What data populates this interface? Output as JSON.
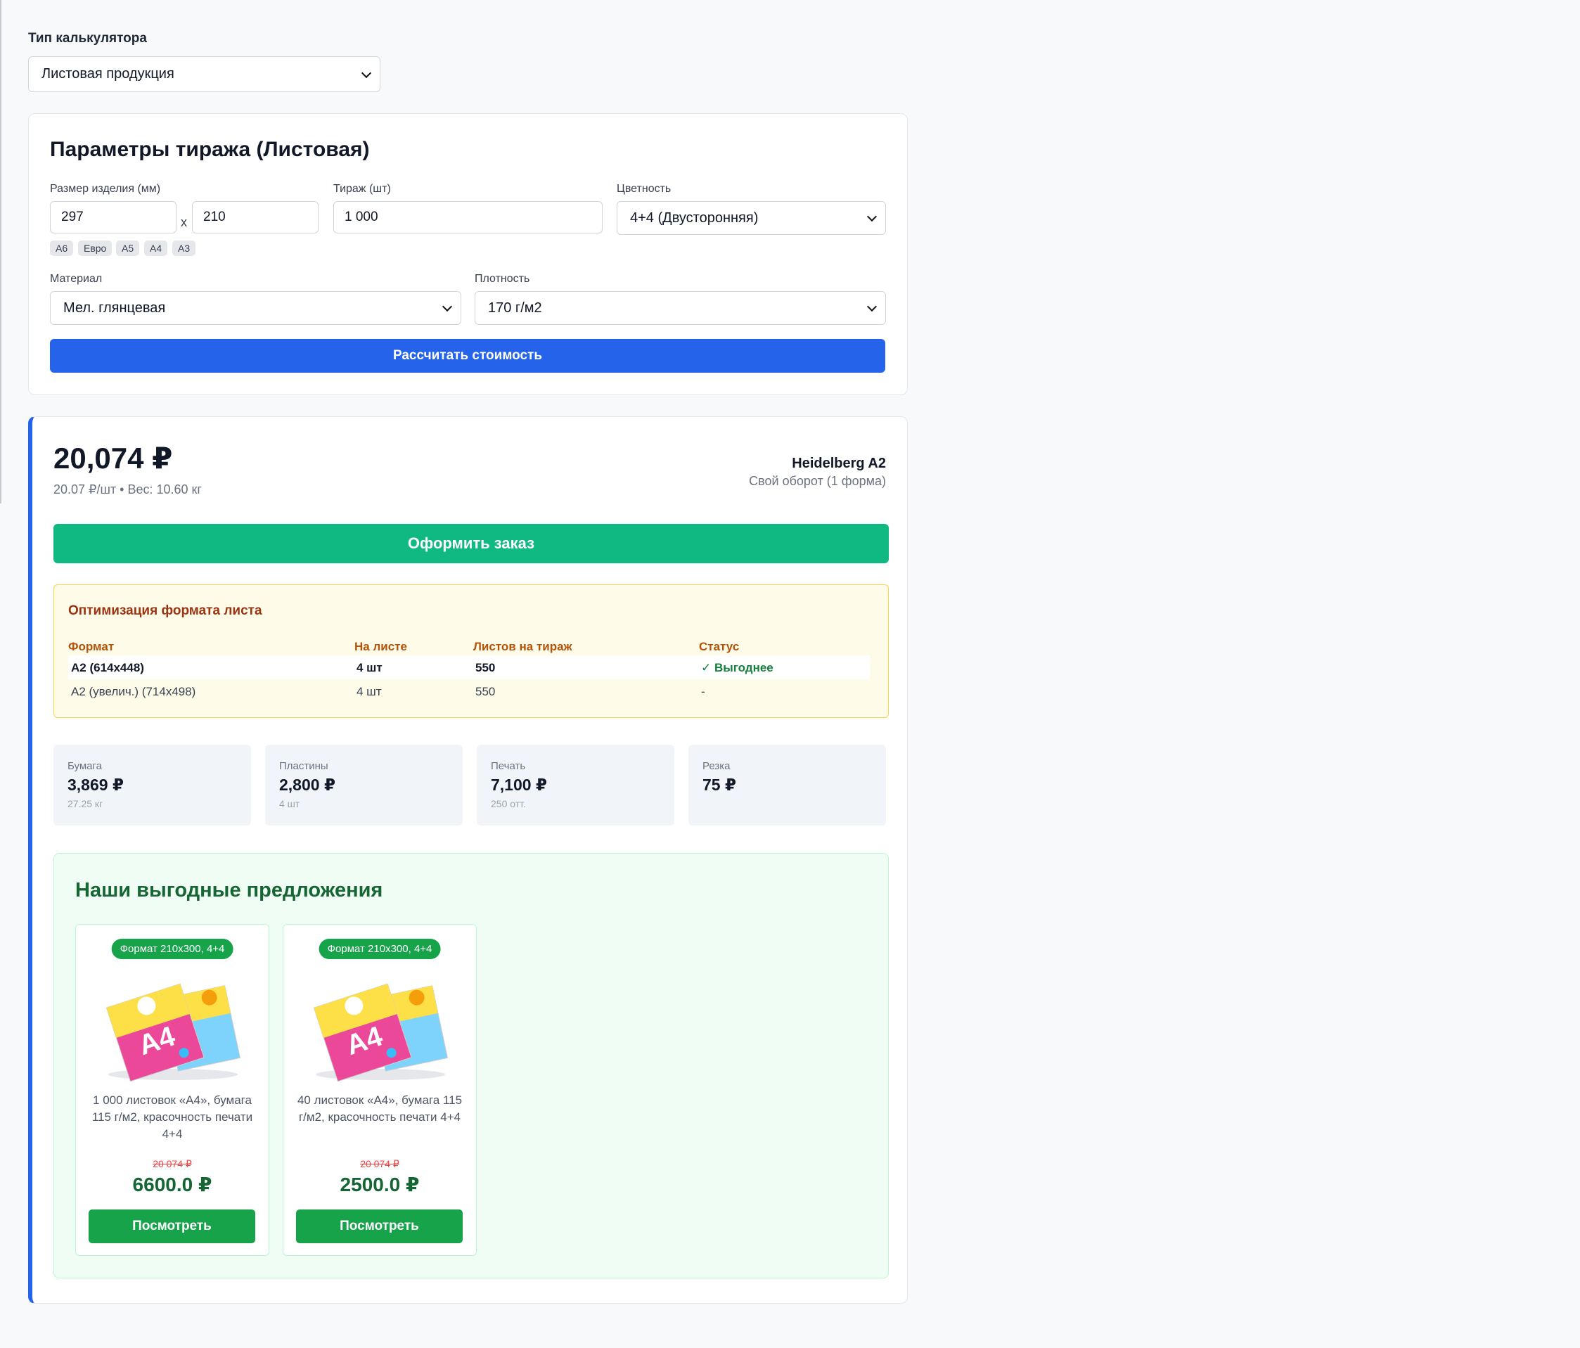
{
  "calc_type": {
    "label": "Тип калькулятора",
    "value": "Листовая продукция"
  },
  "params": {
    "title": "Параметры тиража (Листовая)",
    "size_label": "Размер изделия (мм)",
    "width": "297",
    "height": "210",
    "times": "x",
    "presets": [
      "А6",
      "Евро",
      "А5",
      "А4",
      "А3"
    ],
    "qty_label": "Тираж (шт)",
    "qty": "1 000",
    "color_label": "Цветность",
    "color": "4+4 (Двусторонняя)",
    "material_label": "Материал",
    "material": "Мел. глянцевая",
    "density_label": "Плотность",
    "density": "170 г/м2",
    "calc_button": "Рассчитать стоимость"
  },
  "result": {
    "total": "20,074 ₽",
    "subline": "20.07 ₽/шт • Вес: 10.60 кг",
    "machine": "Heidelberg A2",
    "machine_sub": "Свой оборот (1 форма)",
    "order_button": "Оформить заказ",
    "accent": "#2563eb"
  },
  "optimization": {
    "title": "Оптимизация формата листа",
    "headers": [
      "Формат",
      "На листе",
      "Листов на тираж",
      "Статус"
    ],
    "rows": [
      {
        "format": "A2 (614x448)",
        "per_sheet": "4 шт",
        "sheets": "550",
        "status": "✓ Выгоднее"
      },
      {
        "format": "A2 (увелич.) (714x498)",
        "per_sheet": "4 шт",
        "sheets": "550",
        "status": "-"
      }
    ]
  },
  "costs": [
    {
      "label": "Бумага",
      "value": "3,869 ₽",
      "sub": "27.25 кг"
    },
    {
      "label": "Пластины",
      "value": "2,800 ₽",
      "sub": "4 шт"
    },
    {
      "label": "Печать",
      "value": "7,100 ₽",
      "sub": "250 отт."
    },
    {
      "label": "Резка",
      "value": "75 ₽",
      "sub": ""
    }
  ],
  "offers": {
    "title": "Наши выгодные предложения",
    "items": [
      {
        "badge": "Формат 210x300, 4+4",
        "text": "1 000 листовок «А4», бумага 115 г/м2, красочность печати 4+4",
        "old_price": "20 074 ₽",
        "price": "6600.0 ₽",
        "button": "Посмотреть",
        "image_icon": "a4-flyer-product-image"
      },
      {
        "badge": "Формат 210x300, 4+4",
        "text": "40 листовок «А4», бумага 115 г/м2, красочность печати 4+4",
        "old_price": "20 074 ₽",
        "price": "2500.0 ₽",
        "button": "Посмотреть",
        "image_icon": "a4-flyer-product-image"
      }
    ]
  }
}
